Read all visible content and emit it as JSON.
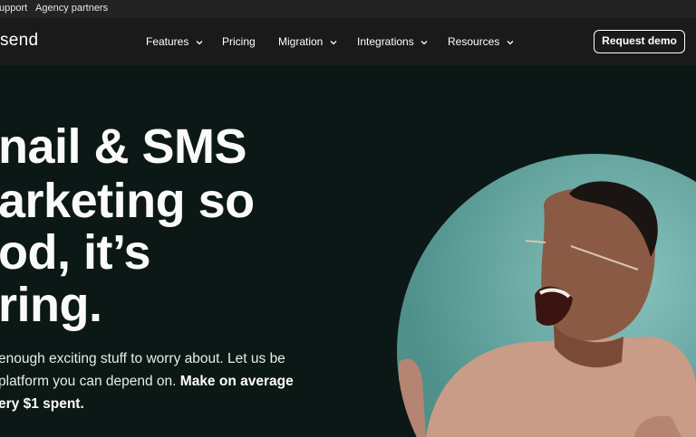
{
  "topbar": {
    "support": "upport",
    "agency": "Agency partners"
  },
  "nav": {
    "logo": "send",
    "items": [
      {
        "label": "Features",
        "has_dropdown": true
      },
      {
        "label": "Pricing",
        "has_dropdown": false
      },
      {
        "label": "Migration",
        "has_dropdown": true
      },
      {
        "label": "Integrations",
        "has_dropdown": true
      },
      {
        "label": "Resources",
        "has_dropdown": true
      }
    ],
    "cta": "Request demo"
  },
  "hero": {
    "headline_lines": [
      "nail & SMS",
      "arketing so",
      "od, it’s",
      "ring."
    ],
    "sub_lines": [
      {
        "plain": "enough exciting stuff to worry about. Let us be",
        "bold": ""
      },
      {
        "plain": "platform you can depend on. ",
        "bold": "Make on average"
      },
      {
        "plain": "",
        "bold": "ery $1 spent."
      }
    ]
  },
  "colors": {
    "background": "#0b1816",
    "nav_bg": "#1a1a1a",
    "topbar_bg": "#222322",
    "photo_bg": "#6fb0ab"
  }
}
